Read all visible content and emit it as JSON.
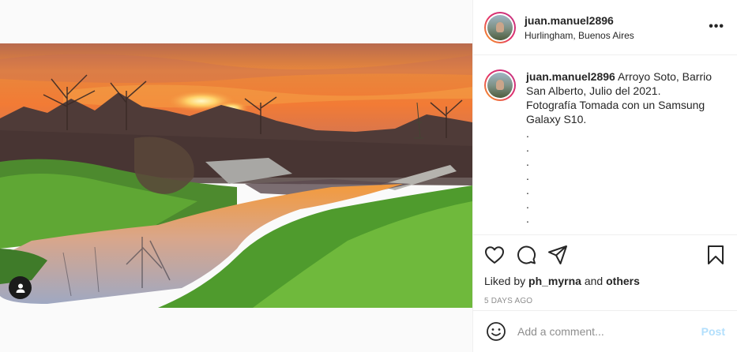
{
  "post": {
    "username": "juan.manuel2896",
    "location": "Hurlingham, Buenos Aires",
    "more_icon": "more-horizontal-icon",
    "caption": {
      "username": "juan.manuel2896",
      "text": "Arroyo Soto, Barrio San Alberto, Julio del 2021.\nFotografía Tomada con un Samsung Galaxy S10.\n.\n.\n.\n.\n.\n.\n."
    },
    "likes": {
      "prefix": "Liked by",
      "user": "ph_myrna",
      "and": "and",
      "others": "others"
    },
    "timestamp": "5 DAYS AGO",
    "comment_box": {
      "placeholder": "Add a comment...",
      "post_label": "Post"
    },
    "icons": [
      "heart-icon",
      "comment-icon",
      "share-icon",
      "bookmark-icon",
      "emoji-icon",
      "user-tag-icon"
    ],
    "colors": {
      "accent_disabled": "#b2dffc",
      "muted_text": "#8e8e8e",
      "border": "#efefef"
    }
  }
}
